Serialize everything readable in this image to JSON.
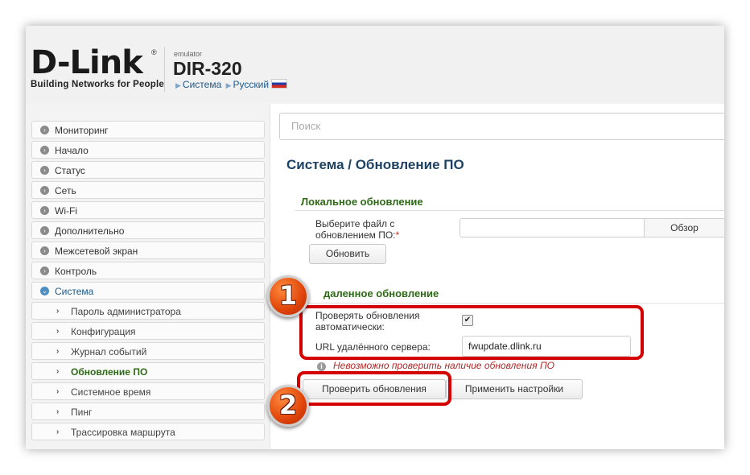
{
  "header": {
    "logo_main": "D-Link",
    "logo_reg": "®",
    "logo_sub": "Building Networks for People",
    "emulator_label": "emulator",
    "model": "DIR-320",
    "crumb_system": "Система",
    "crumb_language": "Русский"
  },
  "sidebar": {
    "items": [
      {
        "label": "Мониторинг"
      },
      {
        "label": "Начало"
      },
      {
        "label": "Статус"
      },
      {
        "label": "Сеть"
      },
      {
        "label": "Wi-Fi"
      },
      {
        "label": "Дополнительно"
      },
      {
        "label": "Межсетевой экран"
      },
      {
        "label": "Контроль"
      },
      {
        "label": "Система"
      }
    ],
    "subitems": [
      {
        "label": "Пароль администратора"
      },
      {
        "label": "Конфигурация"
      },
      {
        "label": "Журнал событий"
      },
      {
        "label": "Обновление ПО"
      },
      {
        "label": "Системное время"
      },
      {
        "label": "Пинг"
      },
      {
        "label": "Трассировка маршрута"
      }
    ]
  },
  "main": {
    "search_placeholder": "Поиск",
    "title": "Система /  Обновление ПО",
    "local": {
      "title": "Локальное обновление",
      "file_label_1": "Выберите файл с",
      "file_label_2": "обновлением ПО:",
      "required_mark": "*",
      "browse_label": "Обзор",
      "update_button": "Обновить"
    },
    "remote": {
      "title": "даленное обновление",
      "auto_check_label_1": "Проверять обновления",
      "auto_check_label_2": "автоматически:",
      "auto_check_mark": "✔",
      "url_label": "URL удалённого сервера:",
      "url_value": "fwupdate.dlink.ru",
      "warning_icon": "i",
      "warning": "Невозможно проверить наличие обновления ПО",
      "check_button": "Проверить обновления",
      "apply_button": "Применить настройки"
    }
  },
  "annotations": {
    "badge_1": "1",
    "badge_2": "2",
    "highlight_color": "#d40000"
  }
}
